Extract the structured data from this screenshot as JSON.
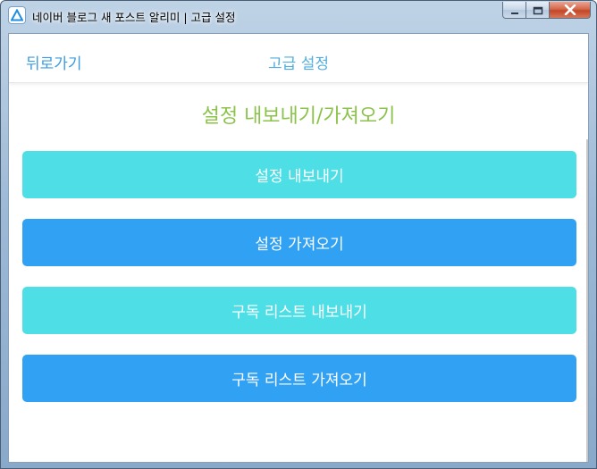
{
  "window": {
    "title": "네이버 블로그 새 포스트 알리미 | 고급 설정"
  },
  "nav": {
    "back_label": "뒤로가기",
    "title": "고급 설정"
  },
  "section": {
    "heading": "설정 내보내기/가져오기"
  },
  "actions": [
    {
      "label": "설정 내보내기",
      "color": "#4ddfe5"
    },
    {
      "label": "설정 가져오기",
      "color": "#30a1f3"
    },
    {
      "label": "구독 리스트 내보내기",
      "color": "#4ddfe5"
    },
    {
      "label": "구독 리스트 가져오기",
      "color": "#30a1f3"
    }
  ],
  "colors": {
    "accent_blue": "#3d9be0",
    "heading_green": "#8bc34a"
  }
}
